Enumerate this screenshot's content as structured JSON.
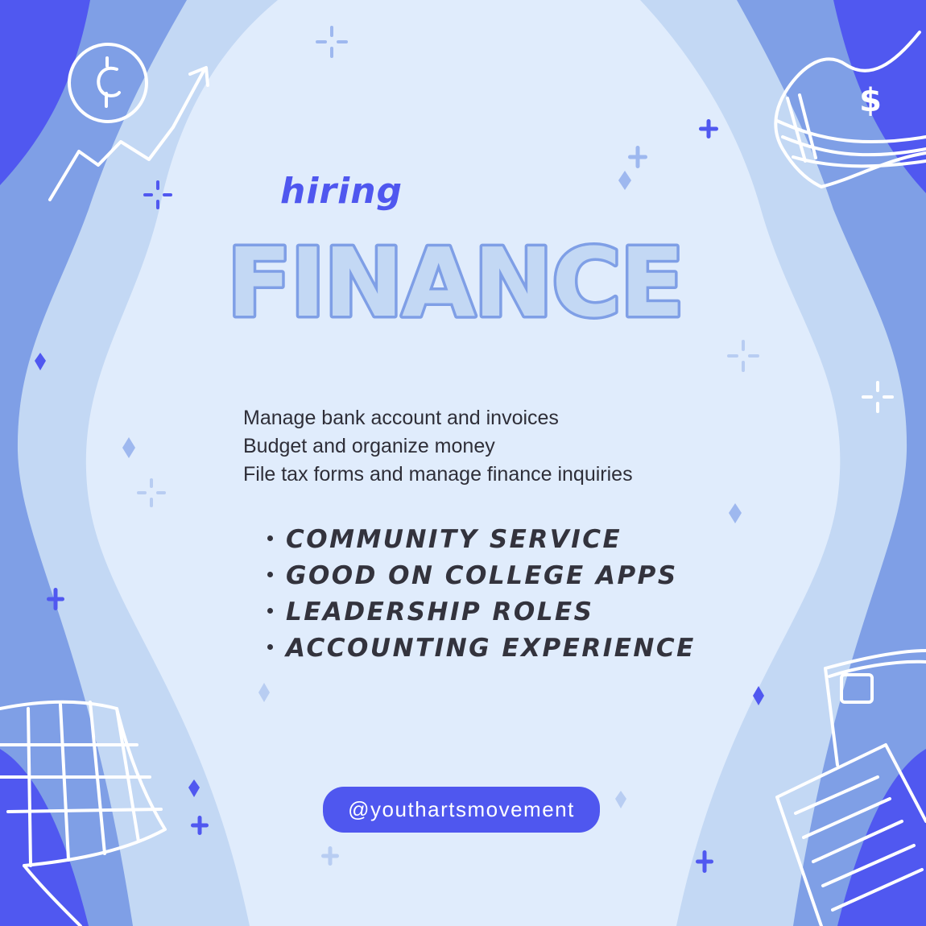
{
  "poster": {
    "tagline": "hiring",
    "headline": "FINANCE",
    "duties": [
      "Manage bank account and invoices",
      "Budget and organize money",
      "File tax forms and manage finance inquiries"
    ],
    "benefits": [
      "COMMUNITY SERVICE",
      "GOOD ON COLLEGE APPS",
      "LEADERSHIP ROLES",
      "ACCOUNTING EXPERIENCE"
    ],
    "handle": "@youthartsmovement",
    "icons": {
      "coin": "cent",
      "money": "$"
    }
  },
  "colors": {
    "background": "#e0ecfc",
    "band_light": "#c3d8f4",
    "band_mid": "#7f9fe6",
    "band_dark": "#5058f0",
    "accent": "#4f57ef",
    "text": "#2e2e38"
  }
}
